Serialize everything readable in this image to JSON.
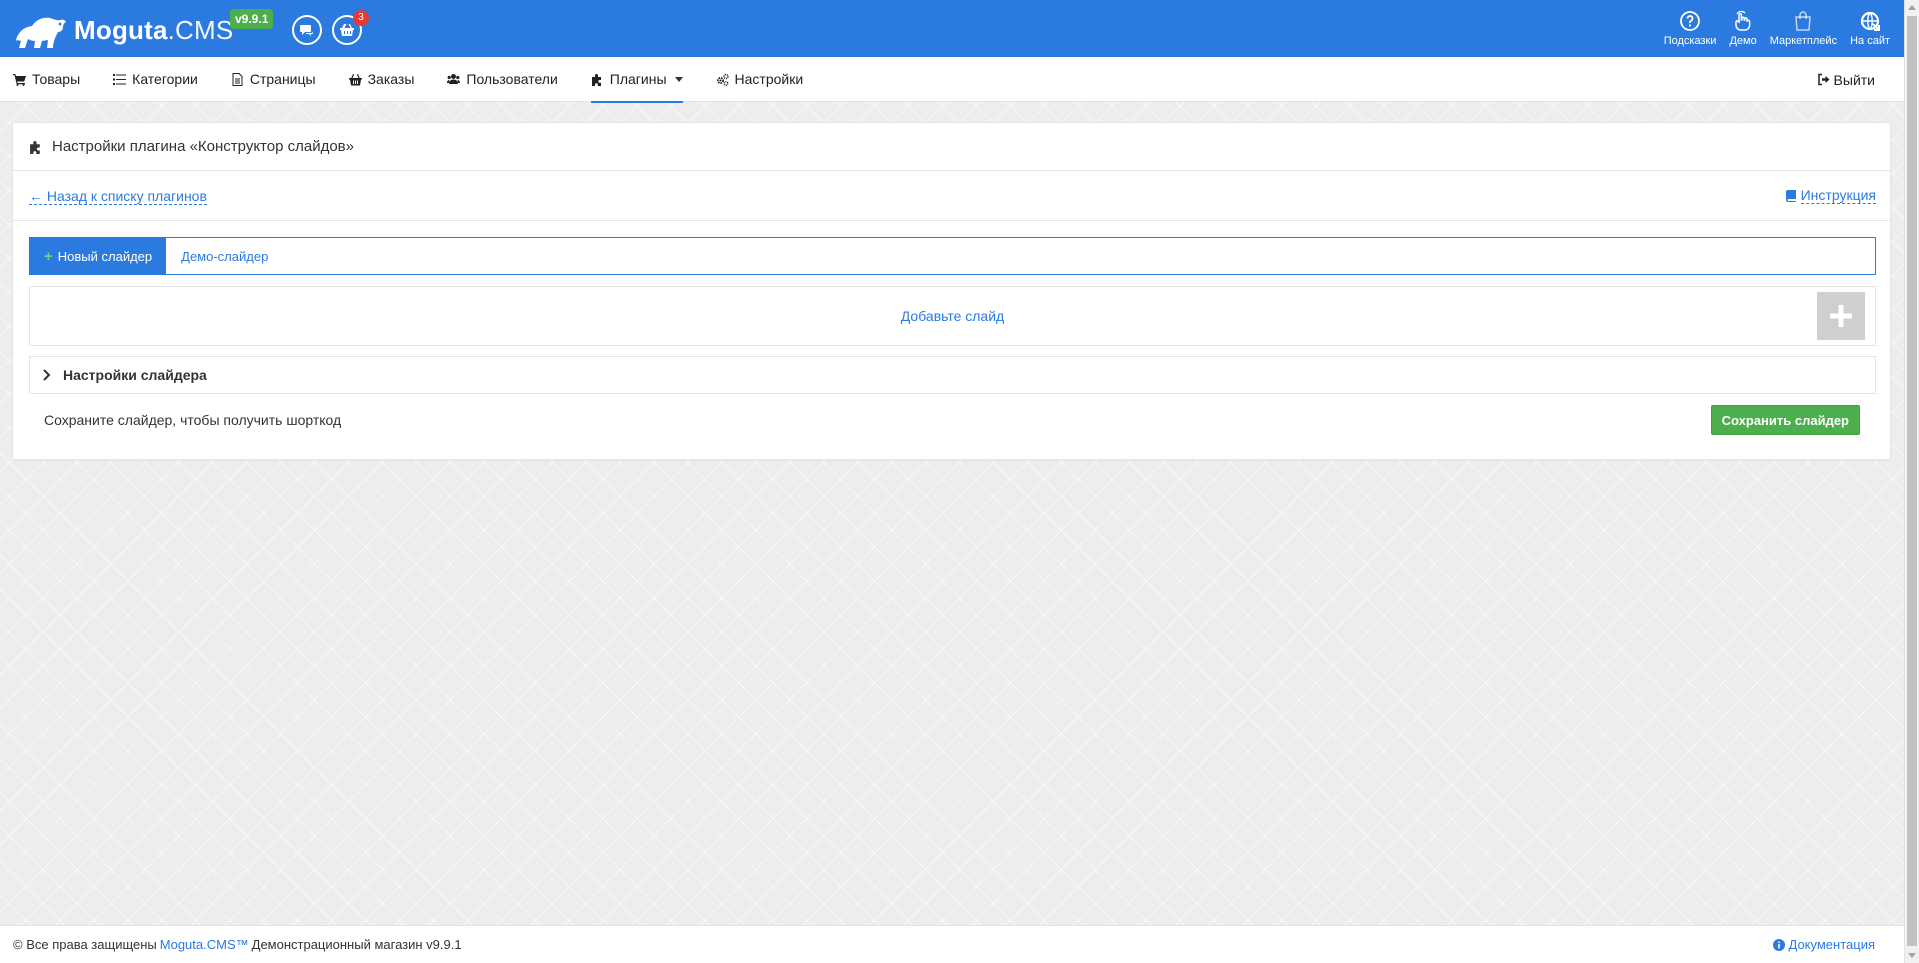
{
  "header": {
    "logo_bold": "Moguta",
    "logo_light": ".CMS",
    "version": "v9.9.1",
    "cart_count": "3",
    "links": [
      {
        "label": "Подсказки",
        "icon": "help-circle-icon"
      },
      {
        "label": "Демо",
        "icon": "hand-pointer-icon"
      },
      {
        "label": "Маркетплейс",
        "icon": "shopping-bag-icon"
      },
      {
        "label": "На сайт",
        "icon": "external-site-icon"
      }
    ]
  },
  "nav": {
    "items": [
      {
        "label": "Товары",
        "icon": "cart-icon"
      },
      {
        "label": "Категории",
        "icon": "list-icon"
      },
      {
        "label": "Страницы",
        "icon": "file-icon"
      },
      {
        "label": "Заказы",
        "icon": "basket-icon"
      },
      {
        "label": "Пользователи",
        "icon": "users-icon"
      },
      {
        "label": "Плагины",
        "icon": "puzzle-icon",
        "active": true
      },
      {
        "label": "Настройки",
        "icon": "gears-icon"
      }
    ],
    "logout": "Выйти"
  },
  "panel": {
    "title": "Настройки плагина «Конструктор слайдов»",
    "back_link": "← Назад к списку плагинов",
    "doc_link": "Инструкция",
    "tabs": {
      "new_slider": "Новый слайдер",
      "demo_slider": "Демо-слайдер"
    },
    "add_slide": "Добавьте слайд",
    "slider_settings": "Настройки слайдера",
    "shortcode_note": "Сохраните слайдер, чтобы получить шорткод",
    "save_button": "Сохранить слайдер"
  },
  "footer": {
    "copyright": "© Все права защищены",
    "brand": "Moguta.CMS™",
    "store": "Демонстрационный магазин v9.9.1",
    "docs": "Документация"
  },
  "colors": {
    "primary": "#2b7ae0",
    "success": "#4cae4c",
    "danger": "#e53935"
  }
}
